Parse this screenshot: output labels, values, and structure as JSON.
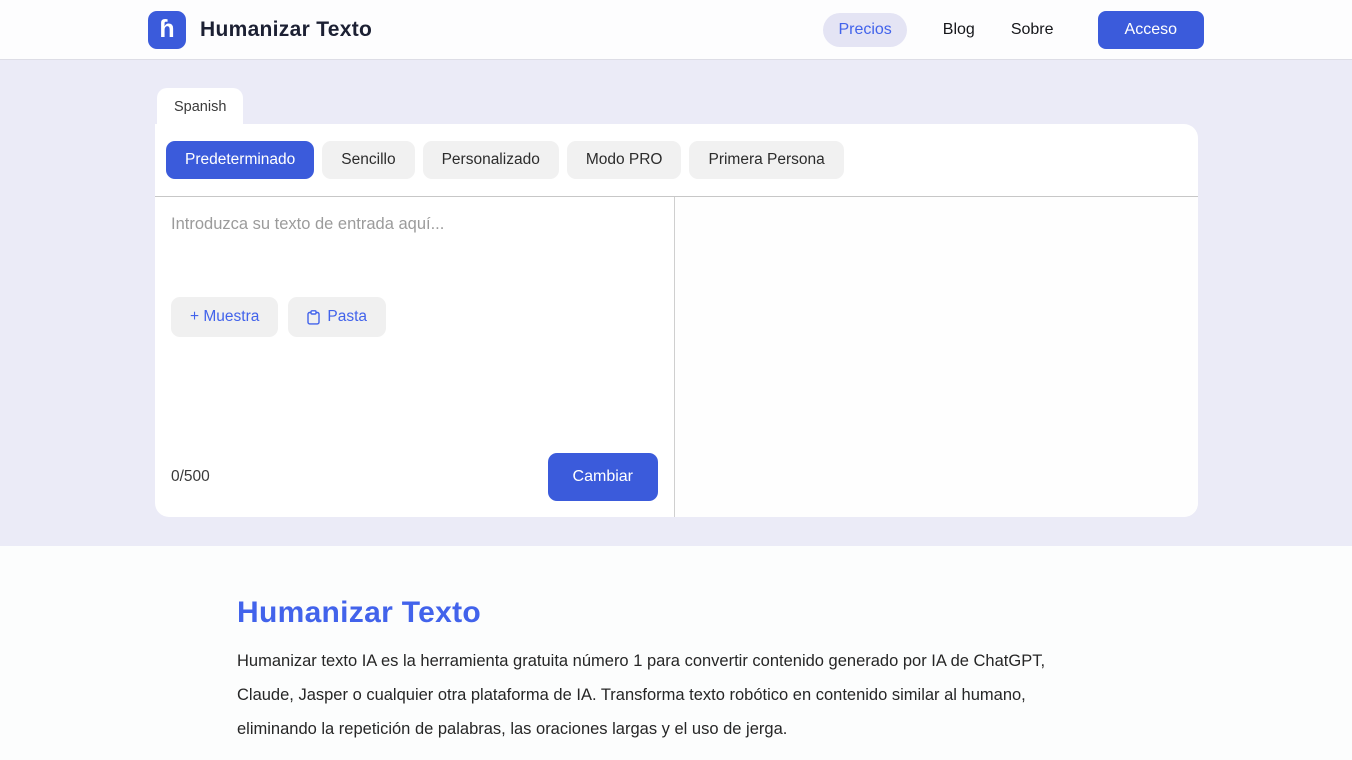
{
  "header": {
    "brand": {
      "logo_glyph": "ɦ",
      "title": "Humanizar Texto"
    },
    "nav": [
      {
        "label": "Precios"
      },
      {
        "label": "Blog"
      },
      {
        "label": "Sobre"
      }
    ],
    "login_label": "Acceso"
  },
  "tool": {
    "language_tab": "Spanish",
    "modes": [
      {
        "label": "Predeterminado",
        "active": true
      },
      {
        "label": "Sencillo",
        "active": false
      },
      {
        "label": "Personalizado",
        "active": false
      },
      {
        "label": "Modo PRO",
        "active": false
      },
      {
        "label": "Primera Persona",
        "active": false
      }
    ],
    "input": {
      "placeholder": "Introduzca su texto de entrada aquí...",
      "value": "",
      "sample_button_label": "+ Muestra",
      "paste_button_label": "Pasta",
      "char_counter": "0/500",
      "submit_label": "Cambiar"
    },
    "output": {
      "value": ""
    }
  },
  "about": {
    "title": "Humanizar Texto",
    "description": "Humanizar texto IA es la herramienta gratuita número 1 para convertir contenido generado por IA de ChatGPT, Claude, Jasper o cualquier otra plataforma de IA. Transforma texto robótico en contenido similar al humano, eliminando la repetición de palabras, las oraciones largas y el uso de jerga."
  },
  "colors": {
    "primary": "#3b5bdb",
    "accent_text": "#4263eb",
    "page_background": "#ebebf7",
    "footer_background": "#fcfdfd"
  }
}
